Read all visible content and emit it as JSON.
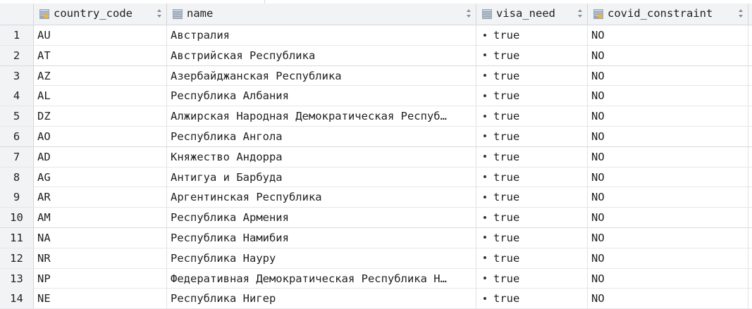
{
  "columns": [
    {
      "label": "country_code",
      "icon": "key-column-icon"
    },
    {
      "label": "name",
      "icon": "column-icon"
    },
    {
      "label": "visa_need",
      "icon": "column-icon"
    },
    {
      "label": "covid_constraint",
      "icon": "key-column-icon"
    }
  ],
  "rows": [
    {
      "n": "1",
      "code": "AU",
      "name": "Австралия",
      "visa": "true",
      "covid": "NO"
    },
    {
      "n": "2",
      "code": "AT",
      "name": "Австрийская Республика",
      "visa": "true",
      "covid": "NO"
    },
    {
      "n": "3",
      "code": "AZ",
      "name": "Азербайджанская Республика",
      "visa": "true",
      "covid": "NO"
    },
    {
      "n": "4",
      "code": "AL",
      "name": "Республика Албания",
      "visa": "true",
      "covid": "NO"
    },
    {
      "n": "5",
      "code": "DZ",
      "name": "Алжирская Народная Демократическая Респуб…",
      "visa": "true",
      "covid": "NO"
    },
    {
      "n": "6",
      "code": "AO",
      "name": "Республика Ангола",
      "visa": "true",
      "covid": "NO"
    },
    {
      "n": "7",
      "code": "AD",
      "name": "Княжество Андорра",
      "visa": "true",
      "covid": "NO"
    },
    {
      "n": "8",
      "code": "AG",
      "name": "Антигуа и Барбуда",
      "visa": "true",
      "covid": "NO"
    },
    {
      "n": "9",
      "code": "AR",
      "name": "Аргентинская Республика",
      "visa": "true",
      "covid": "NO"
    },
    {
      "n": "10",
      "code": "AM",
      "name": "Республика Армения",
      "visa": "true",
      "covid": "NO"
    },
    {
      "n": "11",
      "code": "NA",
      "name": "Республика Намибия",
      "visa": "true",
      "covid": "NO"
    },
    {
      "n": "12",
      "code": "NR",
      "name": "Республика Науру",
      "visa": "true",
      "covid": "NO"
    },
    {
      "n": "13",
      "code": "NP",
      "name": "Федеративная Демократическая Республика Н…",
      "visa": "true",
      "covid": "NO"
    },
    {
      "n": "14",
      "code": "NE",
      "name": "Республика Нигер",
      "visa": "true",
      "covid": "NO"
    }
  ],
  "colors": {
    "header_bg": "#f2f3f5",
    "grid_line": "#d4d6da",
    "text": "#1f1f1f"
  }
}
